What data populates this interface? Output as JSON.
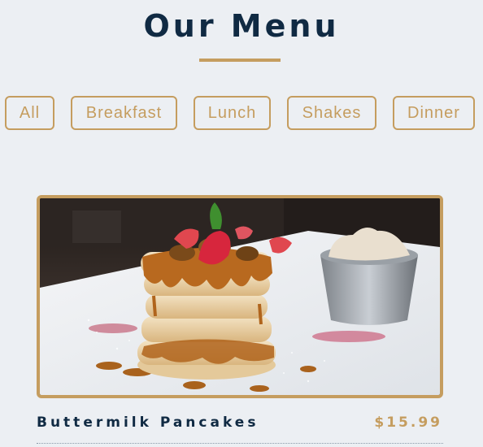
{
  "header": {
    "title": "Our Menu"
  },
  "filters": [
    "All",
    "Breakfast",
    "Lunch",
    "Shakes",
    "Dinner"
  ],
  "menu_items": [
    {
      "name": "Buttermilk Pancakes",
      "price": "$15.99",
      "image": "pancake-stack-photo"
    }
  ],
  "colors": {
    "accent": "#c59d5f",
    "heading": "#102a43",
    "background": "#eceff3"
  }
}
